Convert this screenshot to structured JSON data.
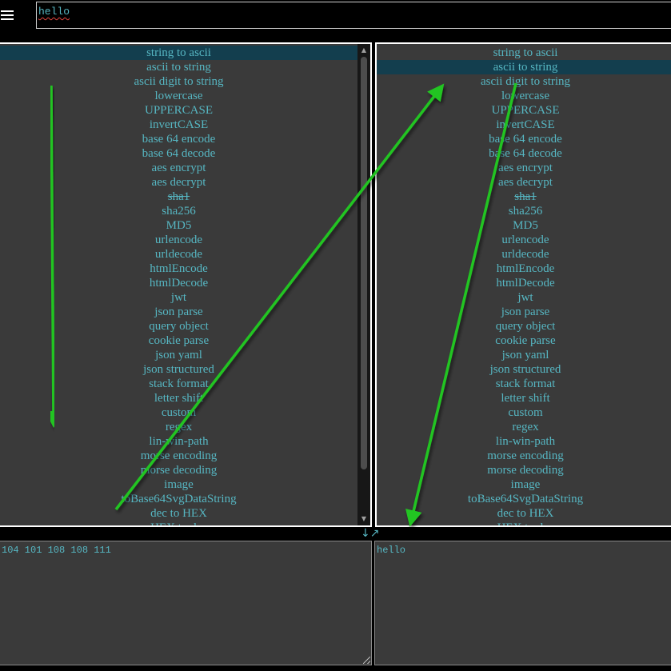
{
  "top_input": {
    "value": "hello"
  },
  "left_list": {
    "selected_index": 0,
    "items": [
      "string to ascii",
      "ascii to string",
      "ascii digit to string",
      "lowercase",
      "UPPERCASE",
      "invertCASE",
      "base 64 encode",
      "base 64 decode",
      "aes encrypt",
      "aes decrypt",
      "sha1",
      "sha256",
      "MD5",
      "urlencode",
      "urldecode",
      "htmlEncode",
      "htmlDecode",
      "jwt",
      "json parse",
      "query object",
      "cookie parse",
      "json yaml",
      "json structured",
      "stack format",
      "letter shift",
      "custom",
      "regex",
      "lin-win-path",
      "morse encoding",
      "morse decoding",
      "image",
      "toBase64SvgDataString",
      "dec to HEX",
      "HEX to dec"
    ]
  },
  "right_list": {
    "selected_index": 1,
    "items": [
      "string to ascii",
      "ascii to string",
      "ascii digit to string",
      "lowercase",
      "UPPERCASE",
      "invertCASE",
      "base 64 encode",
      "base 64 decode",
      "aes encrypt",
      "aes decrypt",
      "sha1",
      "sha256",
      "MD5",
      "urlencode",
      "urldecode",
      "htmlEncode",
      "htmlDecode",
      "jwt",
      "json parse",
      "query object",
      "cookie parse",
      "json yaml",
      "json structured",
      "stack format",
      "letter shift",
      "custom",
      "regex",
      "lin-win-path",
      "morse encoding",
      "morse decoding",
      "image",
      "toBase64SvgDataString",
      "dec to HEX",
      "HEX to dec"
    ]
  },
  "struck_items": [
    "sha1"
  ],
  "swap_icon": {
    "name": "swap-arrows-icon",
    "glyph": "↓↗"
  },
  "left_output": {
    "value": "104 101 108 108 111"
  },
  "right_output": {
    "value": "hello"
  },
  "colors": {
    "text": "#56b6c2",
    "panel_bg": "#3a3a3a",
    "selected_bg": "#133e4e",
    "annotation_arrow": "#22c422"
  }
}
